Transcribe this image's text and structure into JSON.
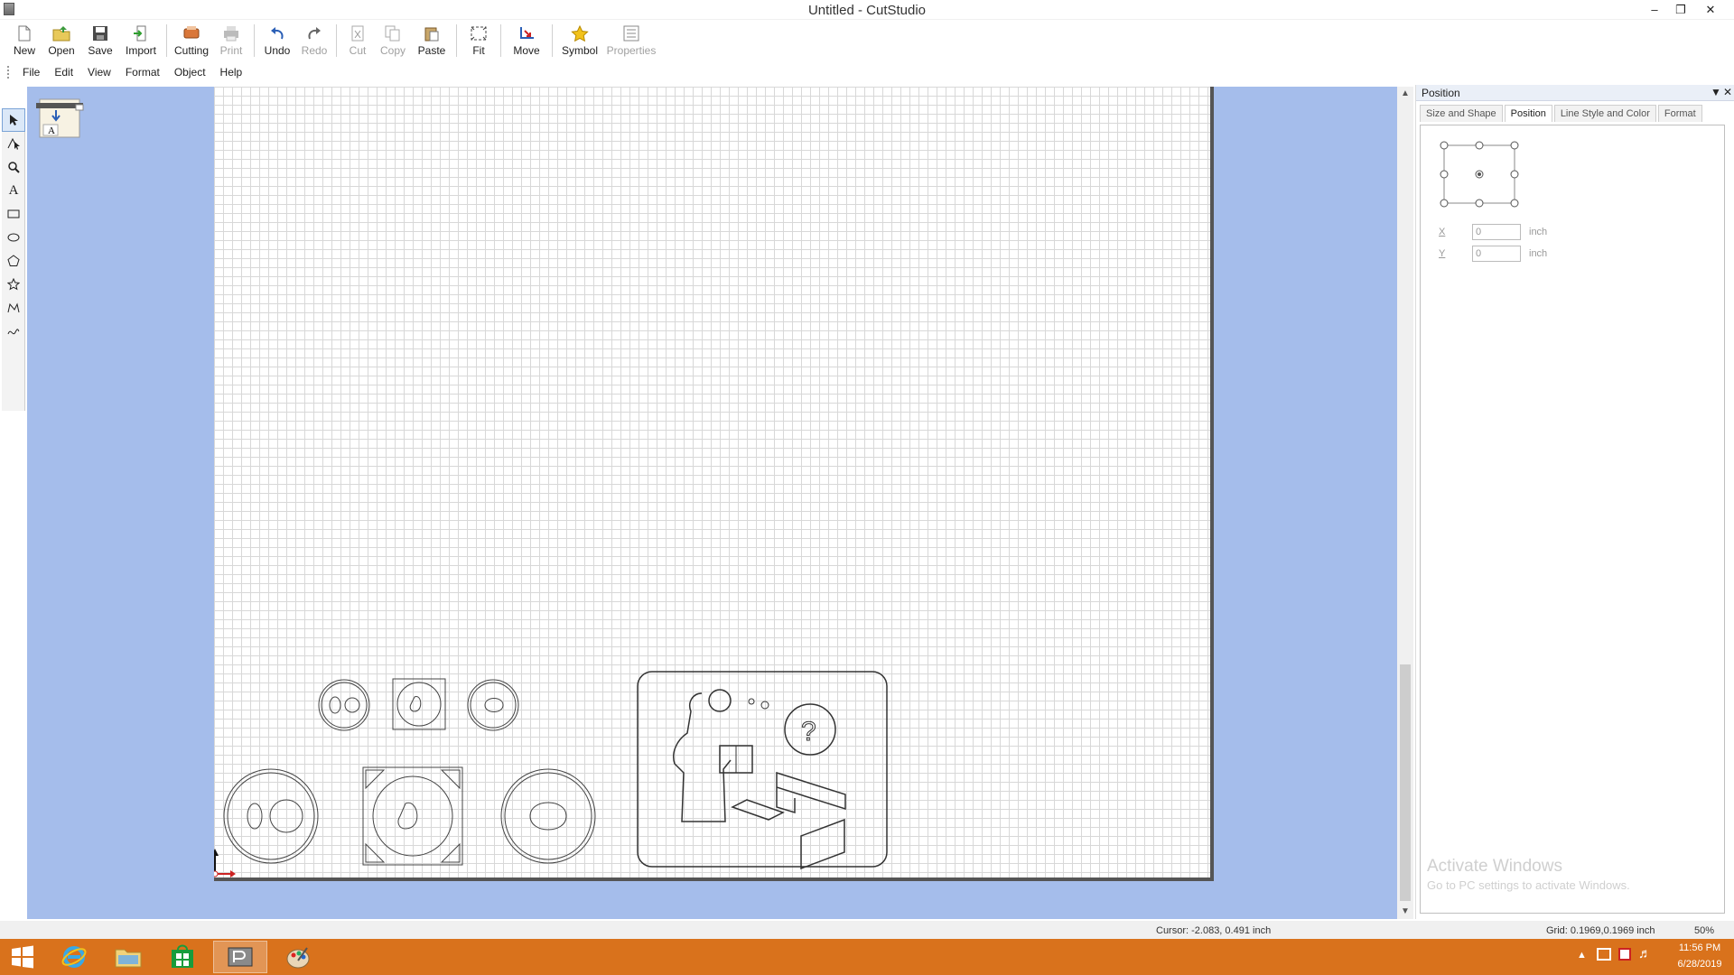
{
  "window": {
    "title": "Untitled - CutStudio"
  },
  "toolbar": {
    "items": [
      {
        "label": "New",
        "enabled": true
      },
      {
        "label": "Open",
        "enabled": true
      },
      {
        "label": "Save",
        "enabled": true
      },
      {
        "label": "Import",
        "enabled": true
      },
      {
        "label": "Cutting",
        "enabled": true
      },
      {
        "label": "Print",
        "enabled": false
      },
      {
        "label": "Undo",
        "enabled": true
      },
      {
        "label": "Redo",
        "enabled": false
      },
      {
        "label": "Cut",
        "enabled": false
      },
      {
        "label": "Copy",
        "enabled": false
      },
      {
        "label": "Paste",
        "enabled": true
      },
      {
        "label": "Fit",
        "enabled": true
      },
      {
        "label": "Move",
        "enabled": true
      },
      {
        "label": "Symbol",
        "enabled": true
      },
      {
        "label": "Properties",
        "enabled": false
      }
    ]
  },
  "menu": {
    "items": [
      "File",
      "Edit",
      "View",
      "Format",
      "Object",
      "Help"
    ]
  },
  "panel": {
    "title": "Position",
    "tabs": [
      "Size and Shape",
      "Position",
      "Line Style and Color",
      "Format"
    ],
    "active_tab": "Position",
    "x_label": "X",
    "x_value": "0",
    "x_unit": "inch",
    "y_label": "Y",
    "y_value": "0",
    "y_unit": "inch"
  },
  "watermark": {
    "line1": "Activate Windows",
    "line2": "Go to PC settings to activate Windows."
  },
  "status": {
    "cursor": "Cursor: -2.083, 0.491 inch",
    "grid": "Grid: 0.1969,0.1969 inch",
    "zoom": "50%"
  },
  "clock": {
    "time": "11:56 PM",
    "date": "6/28/2019"
  },
  "colors": {
    "canvas_bg": "#a5bdeb",
    "taskbar": "#d9721c"
  }
}
